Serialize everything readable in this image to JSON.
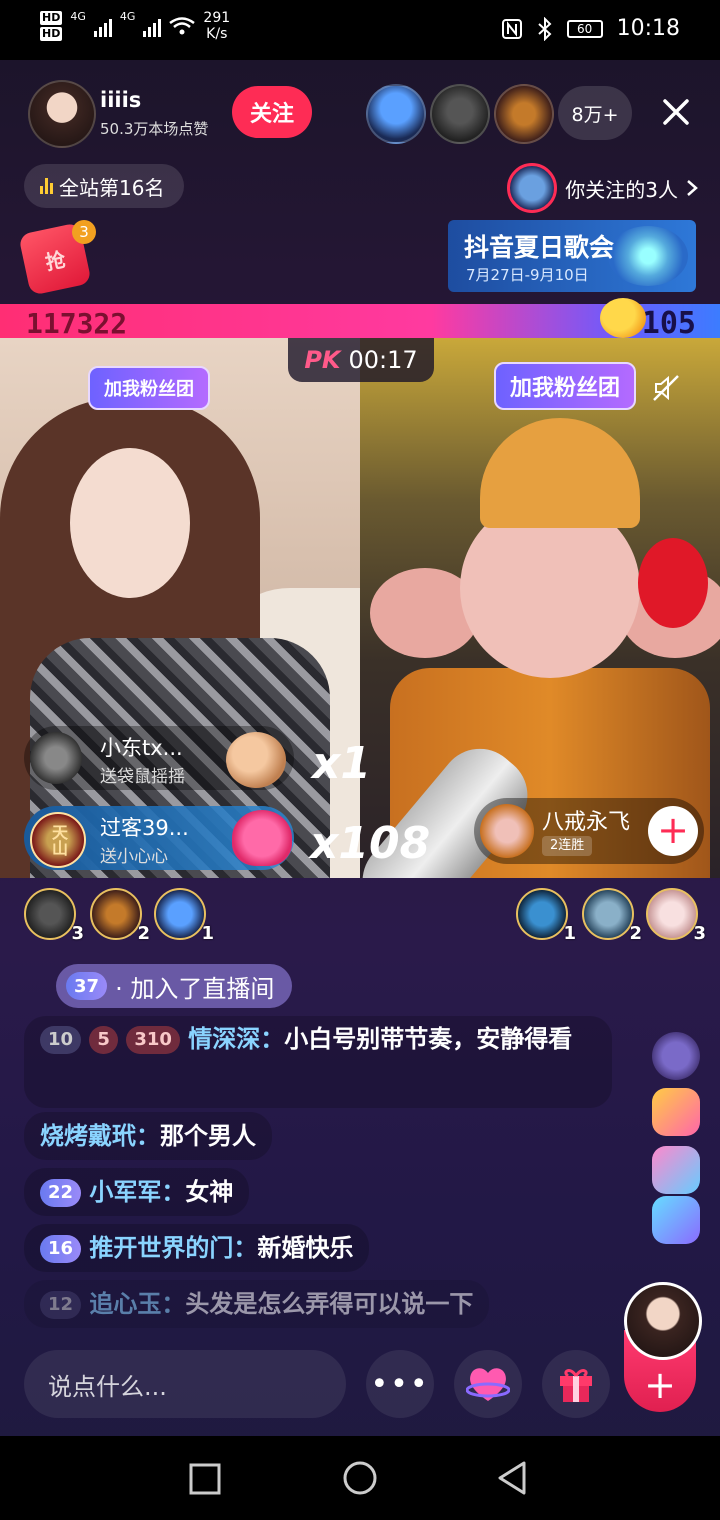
{
  "status_bar": {
    "hd1": "HD",
    "hd2": "HD",
    "net1": "4G",
    "net2": "4G",
    "speed_value": "291",
    "speed_unit": "K/s",
    "battery": "60",
    "time": "10:18",
    "icons": [
      "nfc-icon",
      "bluetooth-icon",
      "battery-icon",
      "wifi-icon",
      "signal-icon"
    ]
  },
  "host": {
    "name": "iiiis",
    "likes": "50.3万本场点赞",
    "follow_label": "关注"
  },
  "viewers": {
    "count": "8万+"
  },
  "rank": {
    "label": "全站第16名"
  },
  "follow_note": {
    "text": "你关注的3人"
  },
  "red_packet": {
    "label": "抢",
    "badge": "3"
  },
  "banner": {
    "title": "抖音夏日歌会",
    "date": "7月27日-9月10日"
  },
  "pk": {
    "left_score": "117322",
    "right_score": "7105",
    "pk_label": "PK",
    "timer": "00:17",
    "colors": {
      "left": "#ff2e74",
      "right": "#3c7cff"
    }
  },
  "fan_tags": {
    "left": "加我粉丝团",
    "right": "加我粉丝团"
  },
  "gifts": [
    {
      "user": "小东tx...",
      "action": "送袋鼠摇摇",
      "combo": "x1"
    },
    {
      "user": "过客39...",
      "action": "送小心心",
      "combo": "x108",
      "avatar_text": "天山"
    }
  ],
  "opponent": {
    "name": "八戒永飞",
    "badge": "2连胜"
  },
  "contributors": {
    "left_ranks": [
      "3",
      "2",
      "1"
    ],
    "right_ranks": [
      "1",
      "2",
      "3"
    ]
  },
  "join_notice": {
    "level": "37",
    "text": "· 加入了直播间"
  },
  "chat": [
    {
      "levels": [
        "10",
        "5",
        "310"
      ],
      "nick": "情深深：",
      "msg": "小白号别带节奏，安静得看"
    },
    {
      "nick": "烧烤戴玳：",
      "msg": "那个男人"
    },
    {
      "level": "22",
      "nick": "小军军：",
      "msg": "女神"
    },
    {
      "level": "16",
      "nick": "推开世界的门：",
      "msg": "新婚快乐"
    },
    {
      "level": "12",
      "nick": "追心玉：",
      "msg": "头发是怎么弄得可以说一下"
    }
  ],
  "bottom_bar": {
    "input_placeholder": "说点什么...",
    "more_label": "•••",
    "plus_label": "+"
  },
  "nav_bar": {
    "icons": [
      "square-icon",
      "circle-icon",
      "back-triangle-icon"
    ]
  },
  "accent": "#fe2c55"
}
